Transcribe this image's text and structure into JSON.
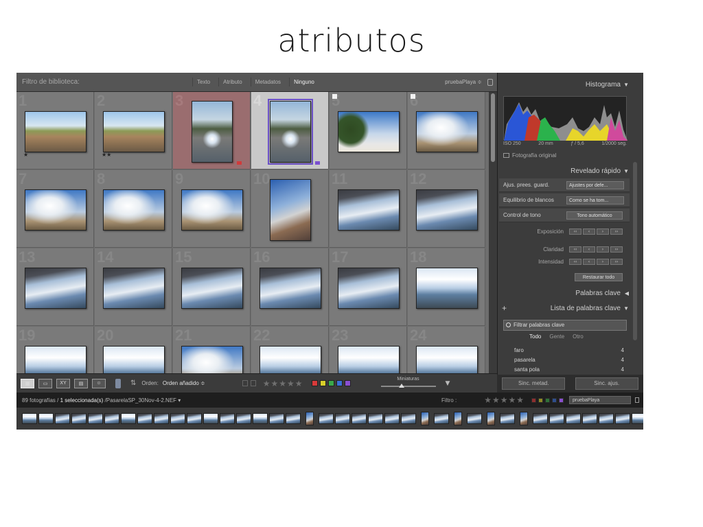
{
  "slide": {
    "title": "atributos"
  },
  "filter_bar": {
    "label": "Filtro de biblioteca:",
    "tabs": [
      {
        "label": "Texto",
        "active": false
      },
      {
        "label": "Atributo",
        "active": false
      },
      {
        "label": "Metadatos",
        "active": false
      },
      {
        "label": "Ninguno",
        "active": true
      }
    ],
    "preset": "pruebaPlaya ≑"
  },
  "grid": {
    "cells": [
      {
        "num": "1",
        "img": "desert",
        "orient": "land",
        "stars": "★"
      },
      {
        "num": "2",
        "img": "desert",
        "orient": "land",
        "stars": "★★"
      },
      {
        "num": "3",
        "img": "puddle",
        "orient": "port",
        "state": "sel-red",
        "label_color": "#d13b3b"
      },
      {
        "num": "4",
        "img": "puddle",
        "orient": "port",
        "state": "sel-white",
        "outline": true,
        "label_color": "#7a4fd0"
      },
      {
        "num": "5",
        "img": "tree",
        "orient": "land",
        "flag": true
      },
      {
        "num": "6",
        "img": "clouds",
        "orient": "land",
        "flag": true
      },
      {
        "num": "7",
        "img": "clouds",
        "orient": "land"
      },
      {
        "num": "8",
        "img": "clouds",
        "orient": "land"
      },
      {
        "num": "9",
        "img": "clouds",
        "orient": "land"
      },
      {
        "num": "10",
        "img": "walkway",
        "orient": "port"
      },
      {
        "num": "11",
        "img": "bridge",
        "orient": "land"
      },
      {
        "num": "12",
        "img": "bridge",
        "orient": "land"
      },
      {
        "num": "13",
        "img": "bridge",
        "orient": "land"
      },
      {
        "num": "14",
        "img": "bridge",
        "orient": "land"
      },
      {
        "num": "15",
        "img": "bridge",
        "orient": "land"
      },
      {
        "num": "16",
        "img": "bridge",
        "orient": "land"
      },
      {
        "num": "17",
        "img": "bridge",
        "orient": "land"
      },
      {
        "num": "18",
        "img": "sea",
        "orient": "land"
      },
      {
        "num": "19",
        "img": "sea",
        "orient": "land"
      },
      {
        "num": "20",
        "img": "sea",
        "orient": "land"
      },
      {
        "num": "21",
        "img": "clouds",
        "orient": "land"
      },
      {
        "num": "22",
        "img": "sea",
        "orient": "land"
      },
      {
        "num": "23",
        "img": "sea",
        "orient": "land"
      },
      {
        "num": "24",
        "img": "sea",
        "orient": "land"
      }
    ]
  },
  "toolbar": {
    "view_buttons": [
      "grid-view",
      "loupe-view",
      "XY",
      "survey-view",
      "people-view"
    ],
    "sort_label": "Orden:",
    "sort_value": "Orden añadido ≑",
    "stars": "★★★★★",
    "colors": [
      "#d83a3a",
      "#d8cf2a",
      "#3aa84a",
      "#3a6fd8",
      "#8a4fd0"
    ],
    "thumb_label": "Miniaturas"
  },
  "panel": {
    "histogram": {
      "title": "Histograma",
      "iso": "ISO 250",
      "focal": "20 mm",
      "aperture": "ƒ / 5,6",
      "shutter": "1/2000 seg.",
      "original": "Fotografía original"
    },
    "quick_develop": {
      "title": "Revelado rápido",
      "preset_label": "Ajus. prees. guard.",
      "preset_value": "Ajustes por defe...",
      "wb_label": "Equilibrio de blancos",
      "wb_value": "Como se ha tom...",
      "tone_label": "Control de tono",
      "tone_button": "Tono automático",
      "exposure": "Exposición",
      "clarity": "Claridad",
      "vibrance": "Intensidad",
      "reset": "Restaurar todo"
    },
    "keywording": {
      "title": "Palabras clave"
    },
    "keyword_list": {
      "title": "Lista de palabras clave",
      "filter": "Filtrar palabras clave",
      "tabs": [
        {
          "label": "Todo",
          "active": true
        },
        {
          "label": "Gente",
          "active": false
        },
        {
          "label": "Otro",
          "active": false
        }
      ],
      "items": [
        {
          "name": "faro",
          "count": "4"
        },
        {
          "name": "pasarela",
          "count": "4"
        },
        {
          "name": "santa pola",
          "count": "4"
        }
      ]
    },
    "sync_metadata": "Sinc. metad.",
    "sync_settings": "Sinc. ajus."
  },
  "filmstrip_bar": {
    "count": "89 fotografías /",
    "selected": "1 seleccionada(s)",
    "file": "/PasarelaSP_30Nov-4-2.NEF ▾",
    "filter_label": "Filtro :",
    "stars": "★★★★★",
    "preset": "pruebaPlaya"
  },
  "filmstrip": {
    "thumbs": [
      "sea",
      "sea",
      "bridge",
      "bridge",
      "bridge",
      "bridge",
      "sea",
      "bridge",
      "bridge",
      "bridge",
      "bridge",
      "sea",
      "bridge",
      "bridge",
      "sea",
      "bridge",
      "bridge",
      "walkway-p",
      "bridge",
      "bridge",
      "bridge",
      "bridge",
      "bridge",
      "bridge",
      "walkway-p",
      "bridge",
      "walkway-p",
      "bridge",
      "walkway-p",
      "bridge",
      "walkway-p",
      "bridge",
      "bridge",
      "bridge",
      "bridge",
      "bridge",
      "bridge",
      "sea"
    ]
  }
}
